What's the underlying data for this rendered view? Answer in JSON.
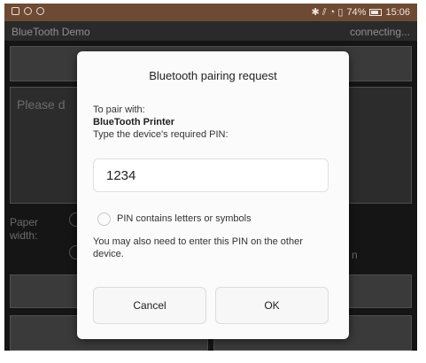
{
  "status_bar": {
    "left_icons": [
      "image-icon",
      "circle-icon",
      "circle-icon"
    ],
    "right_indicators": "✱ ⫽ ◔ ▯",
    "battery_percent": "74%",
    "time": "15:06"
  },
  "app": {
    "title": "BlueTooth Demo",
    "connection_status": "connecting..."
  },
  "background": {
    "placeholder": "Please d",
    "paper_label": "Paper\nwidth:",
    "radio_hint": "n"
  },
  "dialog": {
    "title": "Bluetooth pairing request",
    "to_pair_label": "To pair with:",
    "device_name": "BlueTooth Printer",
    "instruction": "Type the device's required PIN:",
    "pin_value": "1234",
    "checkbox_label": "PIN contains letters or symbols",
    "checkbox_checked": false,
    "note": "You may also need to enter this PIN on the other device.",
    "cancel_label": "Cancel",
    "ok_label": "OK"
  },
  "colors": {
    "status_bar": "#6d4a33",
    "app_background": "#151515",
    "dialog_background": "#fbfbfb"
  }
}
